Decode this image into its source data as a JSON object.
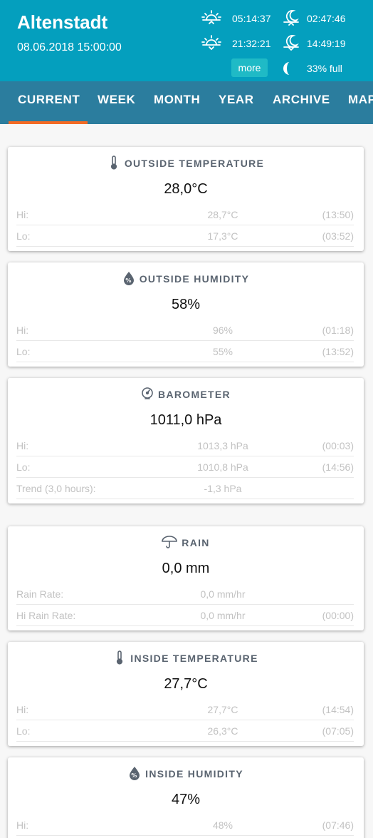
{
  "header": {
    "station": "Altenstadt",
    "datetime": "08.06.2018 15:00:00",
    "sunrise": "05:14:37",
    "sunset": "21:32:21",
    "moonrise": "02:47:46",
    "moonset": "14:49:19",
    "more_label": "more",
    "moon_phase": "33% full"
  },
  "nav": {
    "tabs": [
      "CURRENT",
      "WEEK",
      "MONTH",
      "YEAR",
      "ARCHIVE",
      "MAP"
    ],
    "active": "CURRENT"
  },
  "cards": {
    "outside_temp": {
      "icon": "thermometer-icon",
      "title": "OUTSIDE TEMPERATURE",
      "value": "28,0°C",
      "rows": [
        {
          "label": "Hi:",
          "value": "28,7°C",
          "time": "(13:50)"
        },
        {
          "label": "Lo:",
          "value": "17,3°C",
          "time": "(03:52)"
        }
      ]
    },
    "outside_humidity": {
      "icon": "humidity-drop-icon",
      "title": "OUTSIDE HUMIDITY",
      "value": "58%",
      "rows": [
        {
          "label": "Hi:",
          "value": "96%",
          "time": "(01:18)"
        },
        {
          "label": "Lo:",
          "value": "55%",
          "time": "(13:52)"
        }
      ]
    },
    "barometer": {
      "icon": "gauge-icon",
      "title": "BAROMETER",
      "value": "1011,0 hPa",
      "rows": [
        {
          "label": "Hi:",
          "value": "1013,3 hPa",
          "time": "(00:03)"
        },
        {
          "label": "Lo:",
          "value": "1010,8 hPa",
          "time": "(14:56)"
        },
        {
          "label": "Trend (3,0 hours):",
          "value": "-1,3 hPa",
          "time": ""
        }
      ]
    },
    "rain": {
      "icon": "umbrella-icon",
      "title": "RAIN",
      "value": "0,0 mm",
      "rows": [
        {
          "label": "Rain Rate:",
          "value": "0,0 mm/hr",
          "time": ""
        },
        {
          "label": "Hi Rain Rate:",
          "value": "0,0 mm/hr",
          "time": "(00:00)"
        }
      ]
    },
    "inside_temp": {
      "icon": "thermometer-icon",
      "title": "INSIDE TEMPERATURE",
      "value": "27,7°C",
      "rows": [
        {
          "label": "Hi:",
          "value": "27,7°C",
          "time": "(14:54)"
        },
        {
          "label": "Lo:",
          "value": "26,3°C",
          "time": "(07:05)"
        }
      ]
    },
    "inside_humidity": {
      "icon": "humidity-drop-icon",
      "title": "INSIDE HUMIDITY",
      "value": "47%",
      "rows": [
        {
          "label": "Hi:",
          "value": "48%",
          "time": "(07:46)"
        }
      ]
    }
  },
  "colors": {
    "header_bg": "#049fbe",
    "nav_bg": "#2b7d9e",
    "tab_active_underline": "#f36a24",
    "more_button_bg": "#1fbac6"
  }
}
